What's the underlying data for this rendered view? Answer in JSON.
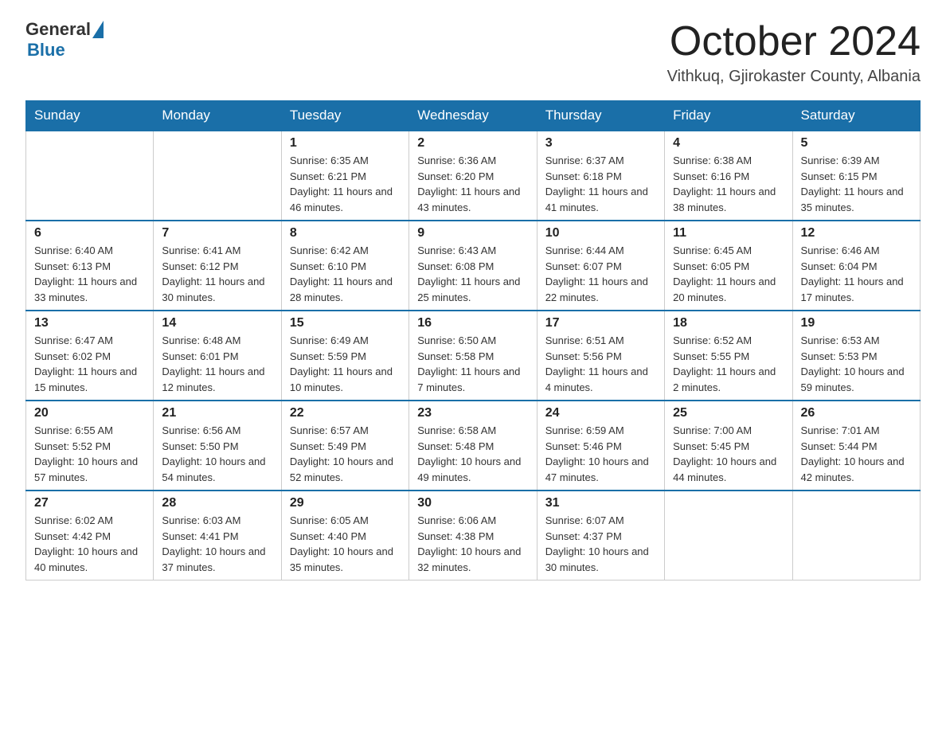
{
  "header": {
    "logo_general": "General",
    "logo_blue": "Blue",
    "month_title": "October 2024",
    "location": "Vithkuq, Gjirokaster County, Albania"
  },
  "days_of_week": [
    "Sunday",
    "Monday",
    "Tuesday",
    "Wednesday",
    "Thursday",
    "Friday",
    "Saturday"
  ],
  "weeks": [
    [
      {
        "day": "",
        "sunrise": "",
        "sunset": "",
        "daylight": ""
      },
      {
        "day": "",
        "sunrise": "",
        "sunset": "",
        "daylight": ""
      },
      {
        "day": "1",
        "sunrise": "Sunrise: 6:35 AM",
        "sunset": "Sunset: 6:21 PM",
        "daylight": "Daylight: 11 hours and 46 minutes."
      },
      {
        "day": "2",
        "sunrise": "Sunrise: 6:36 AM",
        "sunset": "Sunset: 6:20 PM",
        "daylight": "Daylight: 11 hours and 43 minutes."
      },
      {
        "day": "3",
        "sunrise": "Sunrise: 6:37 AM",
        "sunset": "Sunset: 6:18 PM",
        "daylight": "Daylight: 11 hours and 41 minutes."
      },
      {
        "day": "4",
        "sunrise": "Sunrise: 6:38 AM",
        "sunset": "Sunset: 6:16 PM",
        "daylight": "Daylight: 11 hours and 38 minutes."
      },
      {
        "day": "5",
        "sunrise": "Sunrise: 6:39 AM",
        "sunset": "Sunset: 6:15 PM",
        "daylight": "Daylight: 11 hours and 35 minutes."
      }
    ],
    [
      {
        "day": "6",
        "sunrise": "Sunrise: 6:40 AM",
        "sunset": "Sunset: 6:13 PM",
        "daylight": "Daylight: 11 hours and 33 minutes."
      },
      {
        "day": "7",
        "sunrise": "Sunrise: 6:41 AM",
        "sunset": "Sunset: 6:12 PM",
        "daylight": "Daylight: 11 hours and 30 minutes."
      },
      {
        "day": "8",
        "sunrise": "Sunrise: 6:42 AM",
        "sunset": "Sunset: 6:10 PM",
        "daylight": "Daylight: 11 hours and 28 minutes."
      },
      {
        "day": "9",
        "sunrise": "Sunrise: 6:43 AM",
        "sunset": "Sunset: 6:08 PM",
        "daylight": "Daylight: 11 hours and 25 minutes."
      },
      {
        "day": "10",
        "sunrise": "Sunrise: 6:44 AM",
        "sunset": "Sunset: 6:07 PM",
        "daylight": "Daylight: 11 hours and 22 minutes."
      },
      {
        "day": "11",
        "sunrise": "Sunrise: 6:45 AM",
        "sunset": "Sunset: 6:05 PM",
        "daylight": "Daylight: 11 hours and 20 minutes."
      },
      {
        "day": "12",
        "sunrise": "Sunrise: 6:46 AM",
        "sunset": "Sunset: 6:04 PM",
        "daylight": "Daylight: 11 hours and 17 minutes."
      }
    ],
    [
      {
        "day": "13",
        "sunrise": "Sunrise: 6:47 AM",
        "sunset": "Sunset: 6:02 PM",
        "daylight": "Daylight: 11 hours and 15 minutes."
      },
      {
        "day": "14",
        "sunrise": "Sunrise: 6:48 AM",
        "sunset": "Sunset: 6:01 PM",
        "daylight": "Daylight: 11 hours and 12 minutes."
      },
      {
        "day": "15",
        "sunrise": "Sunrise: 6:49 AM",
        "sunset": "Sunset: 5:59 PM",
        "daylight": "Daylight: 11 hours and 10 minutes."
      },
      {
        "day": "16",
        "sunrise": "Sunrise: 6:50 AM",
        "sunset": "Sunset: 5:58 PM",
        "daylight": "Daylight: 11 hours and 7 minutes."
      },
      {
        "day": "17",
        "sunrise": "Sunrise: 6:51 AM",
        "sunset": "Sunset: 5:56 PM",
        "daylight": "Daylight: 11 hours and 4 minutes."
      },
      {
        "day": "18",
        "sunrise": "Sunrise: 6:52 AM",
        "sunset": "Sunset: 5:55 PM",
        "daylight": "Daylight: 11 hours and 2 minutes."
      },
      {
        "day": "19",
        "sunrise": "Sunrise: 6:53 AM",
        "sunset": "Sunset: 5:53 PM",
        "daylight": "Daylight: 10 hours and 59 minutes."
      }
    ],
    [
      {
        "day": "20",
        "sunrise": "Sunrise: 6:55 AM",
        "sunset": "Sunset: 5:52 PM",
        "daylight": "Daylight: 10 hours and 57 minutes."
      },
      {
        "day": "21",
        "sunrise": "Sunrise: 6:56 AM",
        "sunset": "Sunset: 5:50 PM",
        "daylight": "Daylight: 10 hours and 54 minutes."
      },
      {
        "day": "22",
        "sunrise": "Sunrise: 6:57 AM",
        "sunset": "Sunset: 5:49 PM",
        "daylight": "Daylight: 10 hours and 52 minutes."
      },
      {
        "day": "23",
        "sunrise": "Sunrise: 6:58 AM",
        "sunset": "Sunset: 5:48 PM",
        "daylight": "Daylight: 10 hours and 49 minutes."
      },
      {
        "day": "24",
        "sunrise": "Sunrise: 6:59 AM",
        "sunset": "Sunset: 5:46 PM",
        "daylight": "Daylight: 10 hours and 47 minutes."
      },
      {
        "day": "25",
        "sunrise": "Sunrise: 7:00 AM",
        "sunset": "Sunset: 5:45 PM",
        "daylight": "Daylight: 10 hours and 44 minutes."
      },
      {
        "day": "26",
        "sunrise": "Sunrise: 7:01 AM",
        "sunset": "Sunset: 5:44 PM",
        "daylight": "Daylight: 10 hours and 42 minutes."
      }
    ],
    [
      {
        "day": "27",
        "sunrise": "Sunrise: 6:02 AM",
        "sunset": "Sunset: 4:42 PM",
        "daylight": "Daylight: 10 hours and 40 minutes."
      },
      {
        "day": "28",
        "sunrise": "Sunrise: 6:03 AM",
        "sunset": "Sunset: 4:41 PM",
        "daylight": "Daylight: 10 hours and 37 minutes."
      },
      {
        "day": "29",
        "sunrise": "Sunrise: 6:05 AM",
        "sunset": "Sunset: 4:40 PM",
        "daylight": "Daylight: 10 hours and 35 minutes."
      },
      {
        "day": "30",
        "sunrise": "Sunrise: 6:06 AM",
        "sunset": "Sunset: 4:38 PM",
        "daylight": "Daylight: 10 hours and 32 minutes."
      },
      {
        "day": "31",
        "sunrise": "Sunrise: 6:07 AM",
        "sunset": "Sunset: 4:37 PM",
        "daylight": "Daylight: 10 hours and 30 minutes."
      },
      {
        "day": "",
        "sunrise": "",
        "sunset": "",
        "daylight": ""
      },
      {
        "day": "",
        "sunrise": "",
        "sunset": "",
        "daylight": ""
      }
    ]
  ]
}
